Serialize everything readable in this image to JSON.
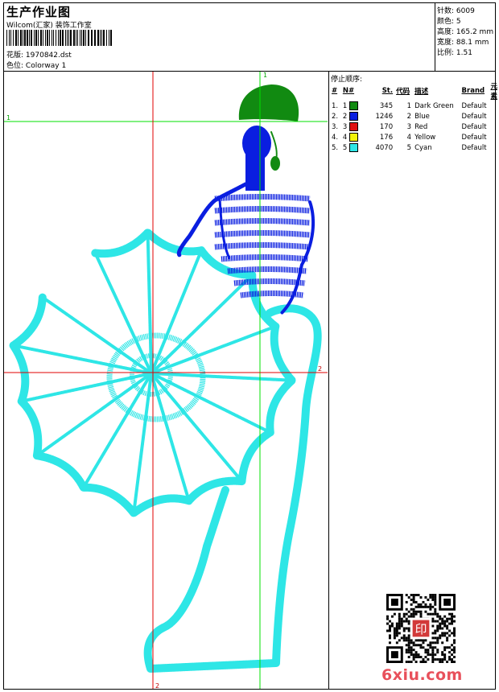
{
  "header": {
    "title": "生产作业图",
    "company": "Wilcom(汇家) 装饰工作室",
    "design_label": "花版:",
    "design_value": "1970842.dst",
    "colorway_label": "色位:",
    "colorway_value": "Colorway 1"
  },
  "stats": [
    {
      "label": "针数:",
      "value": "6009"
    },
    {
      "label": "颜色:",
      "value": "5"
    },
    {
      "label": "高度:",
      "value": "165.2 mm"
    },
    {
      "label": "宽度:",
      "value": "88.1 mm"
    },
    {
      "label": "比例:",
      "value": "1.51"
    }
  ],
  "stop_sequence": {
    "title": "停止顺序:",
    "headers": [
      "#",
      "N#",
      "St.",
      "代码",
      "描述",
      "Brand",
      "元素"
    ],
    "rows": [
      {
        "idx": "1.",
        "n": "1",
        "st": "345",
        "code": "1",
        "desc": "Dark Green",
        "brand": "Default",
        "color": "#118a11"
      },
      {
        "idx": "2.",
        "n": "2",
        "st": "1246",
        "code": "2",
        "desc": "Blue",
        "brand": "Default",
        "color": "#0a1ee0"
      },
      {
        "idx": "3.",
        "n": "3",
        "st": "170",
        "code": "3",
        "desc": "Red",
        "brand": "Default",
        "color": "#e01010"
      },
      {
        "idx": "4.",
        "n": "4",
        "st": "176",
        "code": "4",
        "desc": "Yellow",
        "brand": "Default",
        "color": "#f2f20a"
      },
      {
        "idx": "5.",
        "n": "5",
        "st": "4070",
        "code": "5",
        "desc": "Cyan",
        "brand": "Default",
        "color": "#2ee6e6"
      }
    ]
  },
  "markers": {
    "green_1": "1",
    "red_2": "2"
  },
  "thread_colors": {
    "green": "#118a11",
    "blue": "#0a1ee0",
    "cyan": "#2ee6e6"
  },
  "watermark": {
    "site": "6xiu.com",
    "seal": "印"
  }
}
